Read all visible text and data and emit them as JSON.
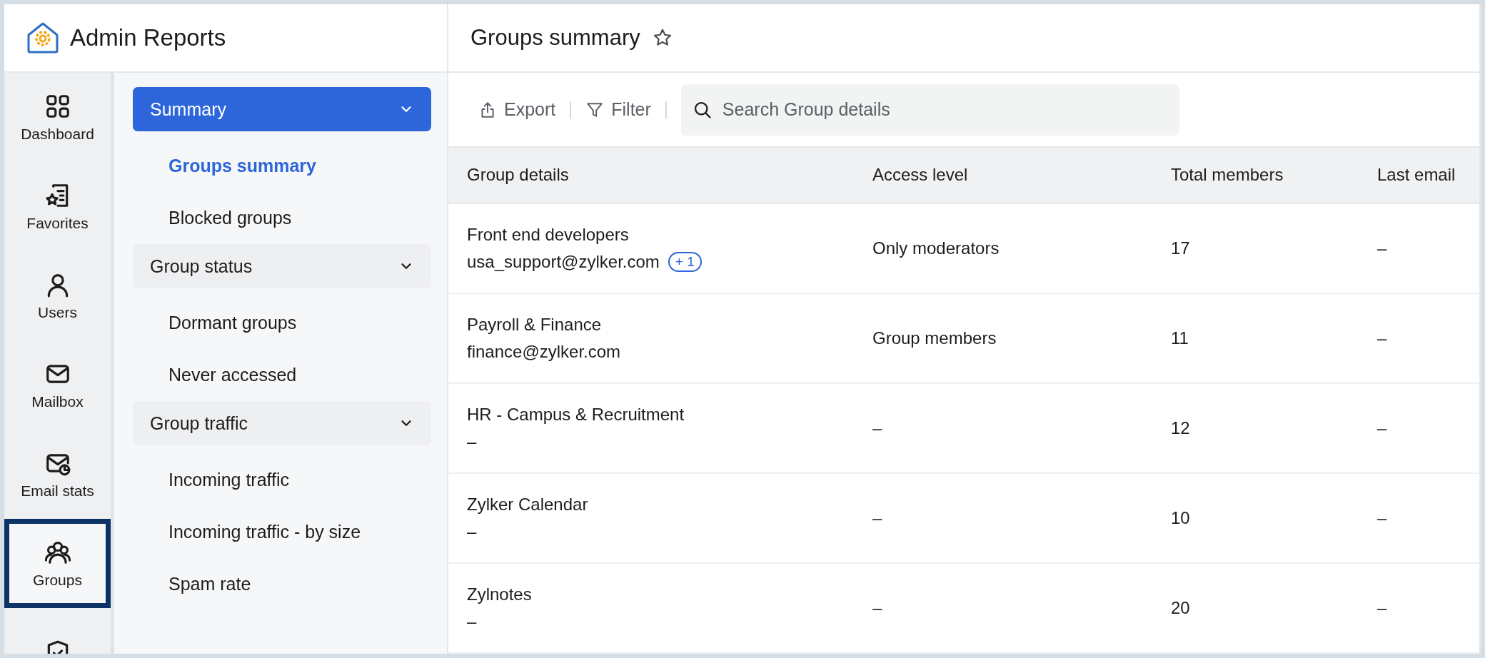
{
  "app": {
    "title": "Admin Reports"
  },
  "nav_rail": [
    {
      "label": "Dashboard",
      "selected": false
    },
    {
      "label": "Favorites",
      "selected": false
    },
    {
      "label": "Users",
      "selected": false
    },
    {
      "label": "Mailbox",
      "selected": false
    },
    {
      "label": "Email stats",
      "selected": false
    },
    {
      "label": "Groups",
      "selected": true
    },
    {
      "selected": false
    }
  ],
  "submenu": [
    {
      "label": "Summary",
      "expanded": true,
      "selected": true,
      "children": [
        {
          "label": "Groups summary",
          "selected": true
        },
        {
          "label": "Blocked groups",
          "selected": false
        }
      ]
    },
    {
      "label": "Group status",
      "expanded": true,
      "selected": false,
      "children": [
        {
          "label": "Dormant groups",
          "selected": false
        },
        {
          "label": "Never accessed",
          "selected": false
        }
      ]
    },
    {
      "label": "Group traffic",
      "expanded": true,
      "selected": false,
      "children": [
        {
          "label": "Incoming traffic",
          "selected": false
        },
        {
          "label": "Incoming traffic - by size",
          "selected": false
        },
        {
          "label": "Spam rate",
          "selected": false
        }
      ]
    }
  ],
  "page": {
    "title": "Groups summary",
    "favorite": false
  },
  "toolbar": {
    "buttons": [
      "Export",
      "Filter"
    ],
    "search": {
      "placeholder": "Search Group details"
    }
  },
  "table": {
    "columns": [
      "Group details",
      "Access level",
      "Total members",
      "Last email"
    ],
    "rows": [
      {
        "name": "Front end developers",
        "email": "usa_support@zylker.com",
        "badge": "+ 1",
        "access": "Only moderators",
        "total": "17",
        "last": "–"
      },
      {
        "name": "Payroll & Finance",
        "email": "finance@zylker.com",
        "access": "Group members",
        "total": "11",
        "last": "–"
      },
      {
        "name": "HR - Campus & Recruitment",
        "email": "–",
        "access": "–",
        "total": "12",
        "last": "–"
      },
      {
        "name": "Zylker Calendar",
        "email": "–",
        "access": "–",
        "total": "10",
        "last": "–"
      },
      {
        "name": "Zylnotes",
        "email": "–",
        "access": "–",
        "total": "20",
        "last": "–"
      }
    ]
  }
}
